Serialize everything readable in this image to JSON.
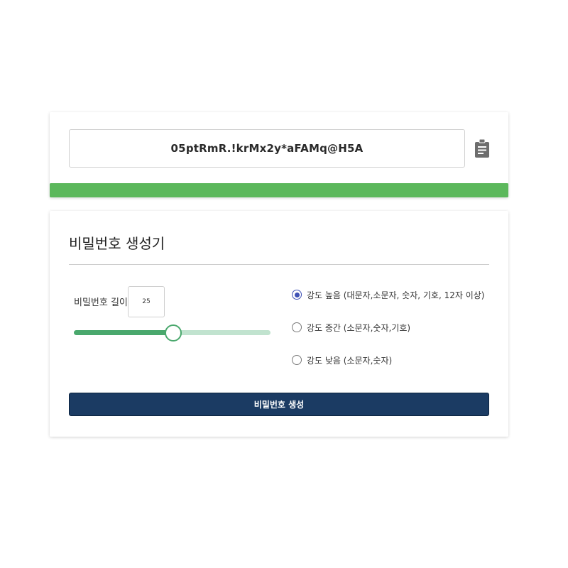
{
  "output": {
    "password": "05ptRmR.!krMx2y*aFAMq@H5A",
    "copy_icon": "clipboard-icon",
    "strength_color": "#5cb85c",
    "strength_level": 1.0
  },
  "generator": {
    "title": "비밀번호 생성기",
    "length_label": "비밀번호 길이",
    "length_value": "25",
    "slider_fraction": 0.5,
    "colors": {
      "slider_active": "#4aa86d",
      "slider_track": "#c1e3cf",
      "radio_accent": "#3f51b5",
      "button_bg": "#1b3b63"
    },
    "options": [
      {
        "label": "강도 높음 (대문자,소문자, 숫자, 기호, 12자 이상)",
        "checked": true
      },
      {
        "label": "강도 중간 (소문자,숫자,기호)",
        "checked": false
      },
      {
        "label": "강도 낮음 (소문자,숫자)",
        "checked": false
      }
    ],
    "button_label": "비밀번호 생성"
  }
}
